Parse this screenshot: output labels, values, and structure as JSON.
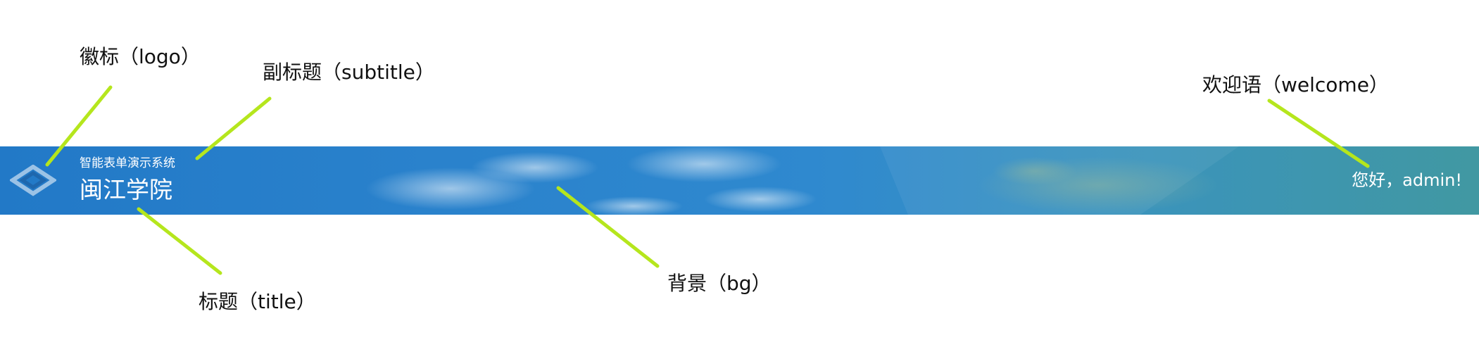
{
  "banner": {
    "subtitle": "智能表单演示系统",
    "title": "闽江学院",
    "welcome": "您好，admin!"
  },
  "callouts": {
    "logo": "徽标（logo）",
    "subtitle": "副标题（subtitle）",
    "welcome": "欢迎语（welcome）",
    "title": "标题（title）",
    "bg": "背景（bg）"
  },
  "colors": {
    "leader_line": "#b5e61d",
    "banner_left": "#2279c7",
    "banner_right": "#4198a2",
    "banner_text": "#ffffff"
  }
}
